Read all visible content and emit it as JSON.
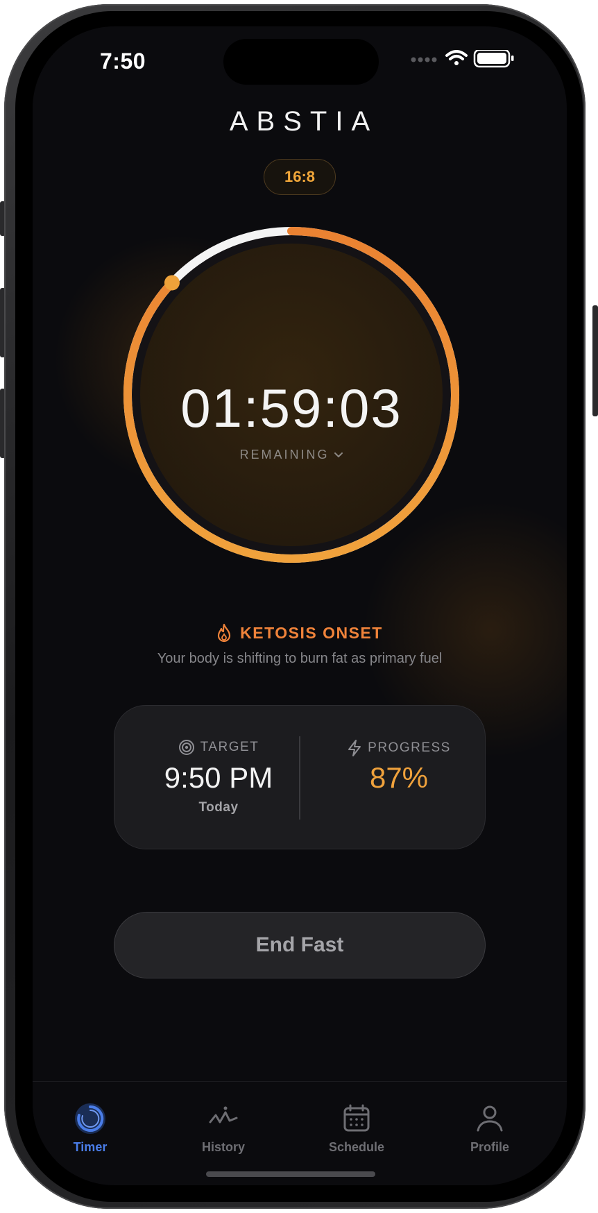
{
  "status_bar": {
    "time": "7:50"
  },
  "app": {
    "title": "ABSTIA",
    "plan_badge": "16:8"
  },
  "timer": {
    "value": "01:59:03",
    "mode_label": "REMAINING",
    "progress_fraction": 0.87
  },
  "phase": {
    "title": "KETOSIS ONSET",
    "description": "Your body is shifting to burn fat as primary fuel",
    "icon": "flame-icon"
  },
  "stats": {
    "target": {
      "label": "TARGET",
      "value": "9:50 PM",
      "sub": "Today",
      "icon": "target-icon"
    },
    "progress": {
      "label": "PROGRESS",
      "value": "87%",
      "icon": "bolt-icon"
    }
  },
  "actions": {
    "end_fast": "End Fast"
  },
  "tabs": [
    {
      "label": "Timer",
      "icon": "timer-icon",
      "active": true
    },
    {
      "label": "History",
      "icon": "history-icon",
      "active": false
    },
    {
      "label": "Schedule",
      "icon": "calendar-icon",
      "active": false
    },
    {
      "label": "Profile",
      "icon": "person-icon",
      "active": false
    }
  ],
  "colors": {
    "accent_orange": "#f0a23c",
    "phase_orange": "#f0833a",
    "active_tab_blue": "#4a7de8",
    "background": "#0b0b0e"
  }
}
